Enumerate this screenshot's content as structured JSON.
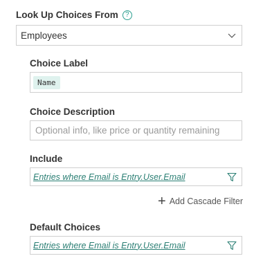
{
  "lookup": {
    "label": "Look Up Choices From",
    "help_glyph": "?",
    "selected": "Employees"
  },
  "choice_label": {
    "label": "Choice Label",
    "token": "Name"
  },
  "choice_description": {
    "label": "Choice Description",
    "placeholder": "Optional info, like price or quantity remaining"
  },
  "include": {
    "label": "Include",
    "filter_text": "Entries where Email is Entry.User.Email"
  },
  "cascade": {
    "plus": "+",
    "label": "Add Cascade Filter"
  },
  "default_choices": {
    "label": "Default Choices",
    "filter_text": "Entries where Email is Entry.User.Email"
  },
  "colors": {
    "accent": "#2b7f74",
    "token_bg": "#dff2ee",
    "border": "#cfcfcf"
  },
  "icons": [
    "help-icon",
    "chevron-down-icon",
    "filter-icon",
    "plus-icon"
  ]
}
